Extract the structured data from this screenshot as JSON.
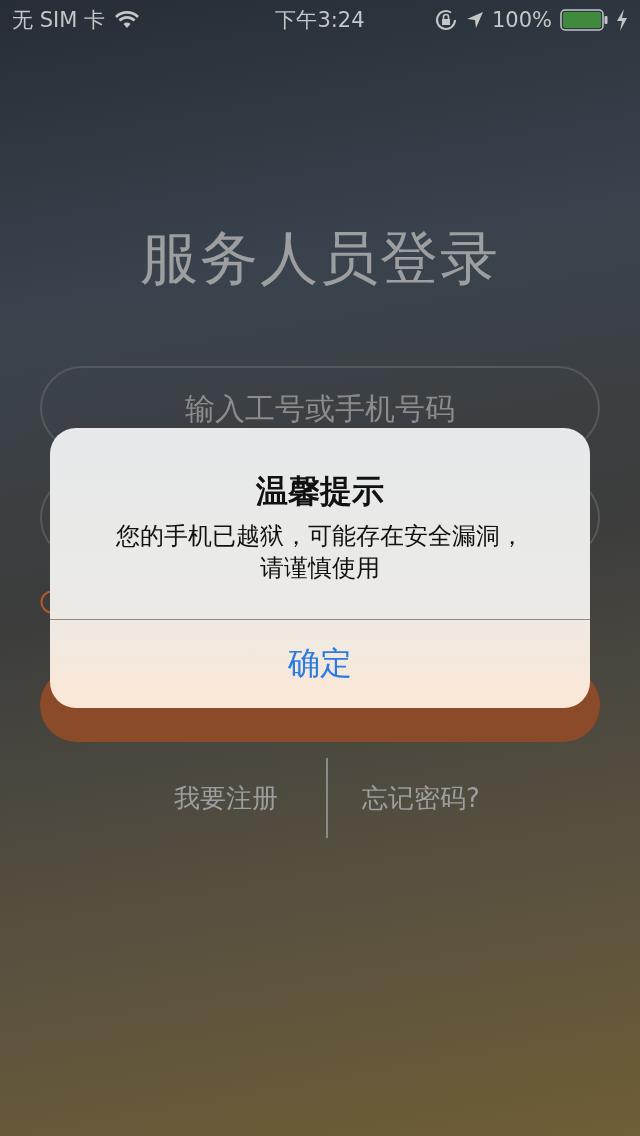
{
  "status_bar": {
    "carrier": "无 SIM 卡",
    "time": "下午3:24",
    "battery": "100%"
  },
  "title": "服务人员登录",
  "account_field": {
    "placeholder": "输入工号或手机号码"
  },
  "links": [
    "我要注册",
    "忘记密码?"
  ],
  "alert": {
    "title": "温馨提示",
    "message": "您的手机已越狱，可能存在安全漏洞，请谨慎使用",
    "button": "确定"
  }
}
